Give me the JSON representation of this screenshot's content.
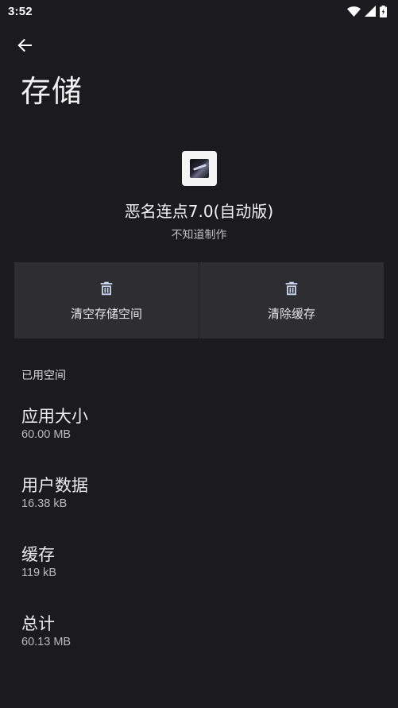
{
  "status_bar": {
    "time": "3:52",
    "icons": [
      "wifi-icon",
      "cellular-signal-icon",
      "battery-icon"
    ]
  },
  "toolbar": {
    "back_icon": "arrow-left-icon",
    "title": "存储"
  },
  "app": {
    "name": "恶名连点7.0(自动版)",
    "developer": "不知道制作"
  },
  "actions": [
    {
      "label": "清空存储空间",
      "icon": "trash-icon"
    },
    {
      "label": "清除缓存",
      "icon": "trash-icon"
    }
  ],
  "storage": {
    "section_label": "已用空间",
    "items": [
      {
        "title": "应用大小",
        "value": "60.00 MB"
      },
      {
        "title": "用户数据",
        "value": "16.38 kB"
      },
      {
        "title": "缓存",
        "value": "119 kB"
      },
      {
        "title": "总计",
        "value": "60.13 MB"
      }
    ]
  },
  "colors": {
    "background": "#1b1b1d",
    "button_surface": "#2d2d32",
    "icon_accent": "#c9d8f0"
  }
}
